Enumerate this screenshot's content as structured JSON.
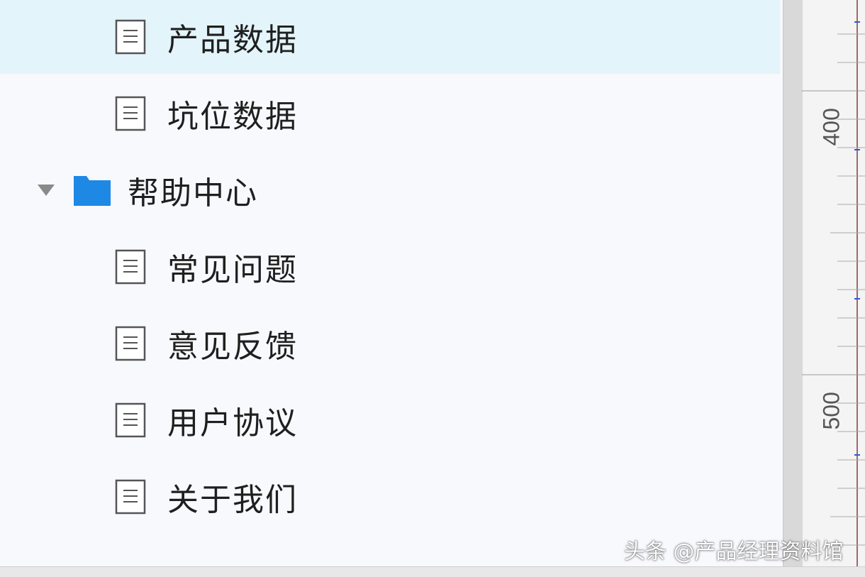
{
  "tree": {
    "items": [
      {
        "label": "产品数据",
        "type": "page",
        "selected": true
      },
      {
        "label": "坑位数据",
        "type": "page",
        "selected": false
      },
      {
        "label": "帮助中心",
        "type": "folder",
        "expanded": true
      },
      {
        "label": "常见问题",
        "type": "page",
        "selected": false
      },
      {
        "label": "意见反馈",
        "type": "page",
        "selected": false
      },
      {
        "label": "用户协议",
        "type": "page",
        "selected": false
      },
      {
        "label": "关于我们",
        "type": "page",
        "selected": false
      }
    ]
  },
  "ruler": {
    "labels": [
      "400",
      "500"
    ]
  },
  "watermark": "头条 @产品经理资料馆",
  "colors": {
    "selected_row": "#e3f4fa",
    "folder_icon": "#1e88e5",
    "background": "#f8f9fd"
  }
}
